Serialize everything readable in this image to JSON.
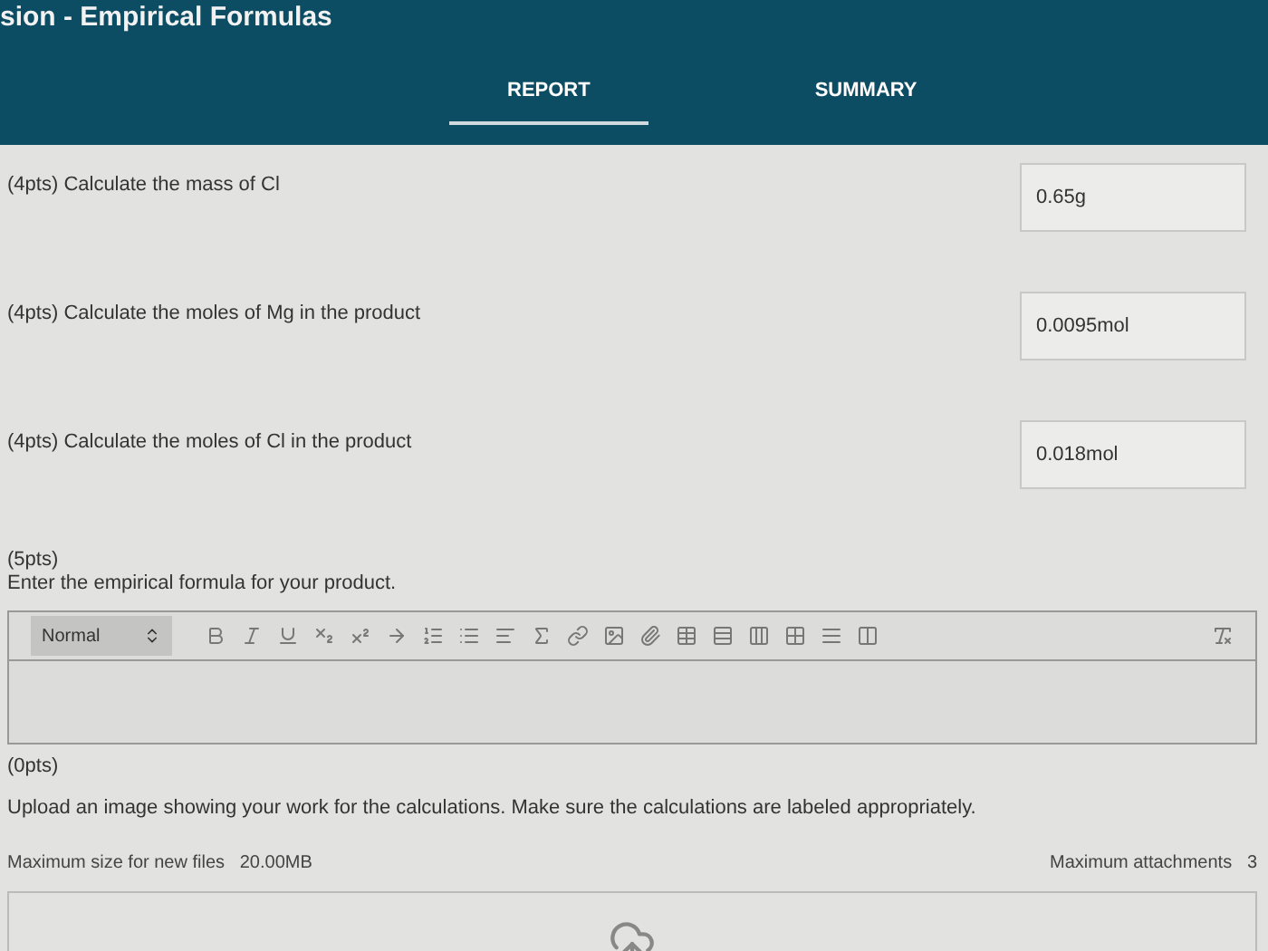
{
  "window": {
    "title": "sion - Empirical Formulas"
  },
  "tabs": [
    {
      "label": "REPORT",
      "selected": true
    },
    {
      "label": "SUMMARY",
      "selected": false
    }
  ],
  "questions": [
    {
      "kind": "answer",
      "points": "(4pts)",
      "prompt": "Calculate the mass of Cl",
      "value": "0.65g"
    },
    {
      "kind": "answer",
      "points": "(4pts)",
      "prompt": "Calculate the moles of Mg in the product",
      "value": "0.0095mol"
    },
    {
      "kind": "answer",
      "points": "(4pts)",
      "prompt": "Calculate the moles of Cl in the product",
      "value": "0.018mol"
    },
    {
      "kind": "editor",
      "points": "(5pts)",
      "prompt": "Enter the empirical formula for your product.",
      "style": "Normal"
    },
    {
      "kind": "upload",
      "points": "(0pts)",
      "prompt": "Upload an image showing your work for the calculations. Make sure the calculations are labeled appropriately.",
      "max_size_label": "Maximum size for new files",
      "max_size": "20.00MB",
      "max_attach_label": "Maximum attachments",
      "max_attach": "3"
    }
  ]
}
